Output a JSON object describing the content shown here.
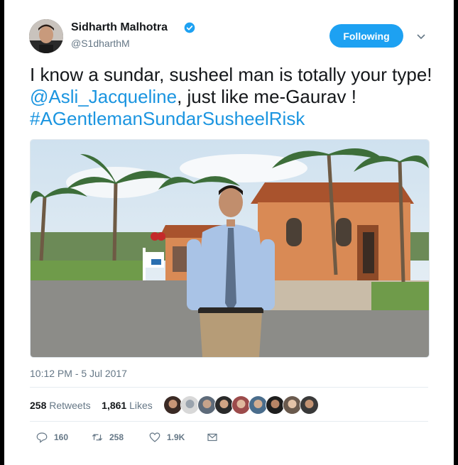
{
  "user": {
    "name": "Sidharth Malhotra",
    "handle": "@S1dharthM",
    "verified": true
  },
  "follow_button": {
    "label": "Following"
  },
  "tweet": {
    "text_part1": "I know a sundar, susheel man is totally your type! ",
    "mention": "@Asli_Jacqueline",
    "text_part2": ", just like me-Gaurav !",
    "hashtag": "#AGentlemanSundarSusheelRisk"
  },
  "timestamp": "10:12 PM - 5 Jul 2017",
  "stats": {
    "retweets_count": "258",
    "retweets_label": "Retweets",
    "likes_count": "1,861",
    "likes_label": "Likes"
  },
  "likers": [
    {
      "icon": "liker-avatar-1"
    },
    {
      "icon": "liker-avatar-2"
    },
    {
      "icon": "liker-avatar-3"
    },
    {
      "icon": "liker-avatar-4"
    },
    {
      "icon": "liker-avatar-5"
    },
    {
      "icon": "liker-avatar-6"
    },
    {
      "icon": "liker-avatar-7"
    },
    {
      "icon": "liker-avatar-8"
    },
    {
      "icon": "liker-avatar-9"
    }
  ],
  "actions": {
    "reply_count": "160",
    "retweet_count": "258",
    "like_count": "1.9K"
  },
  "colors": {
    "accent": "#1da1f2",
    "link": "#1b95e0",
    "muted": "#657786"
  }
}
